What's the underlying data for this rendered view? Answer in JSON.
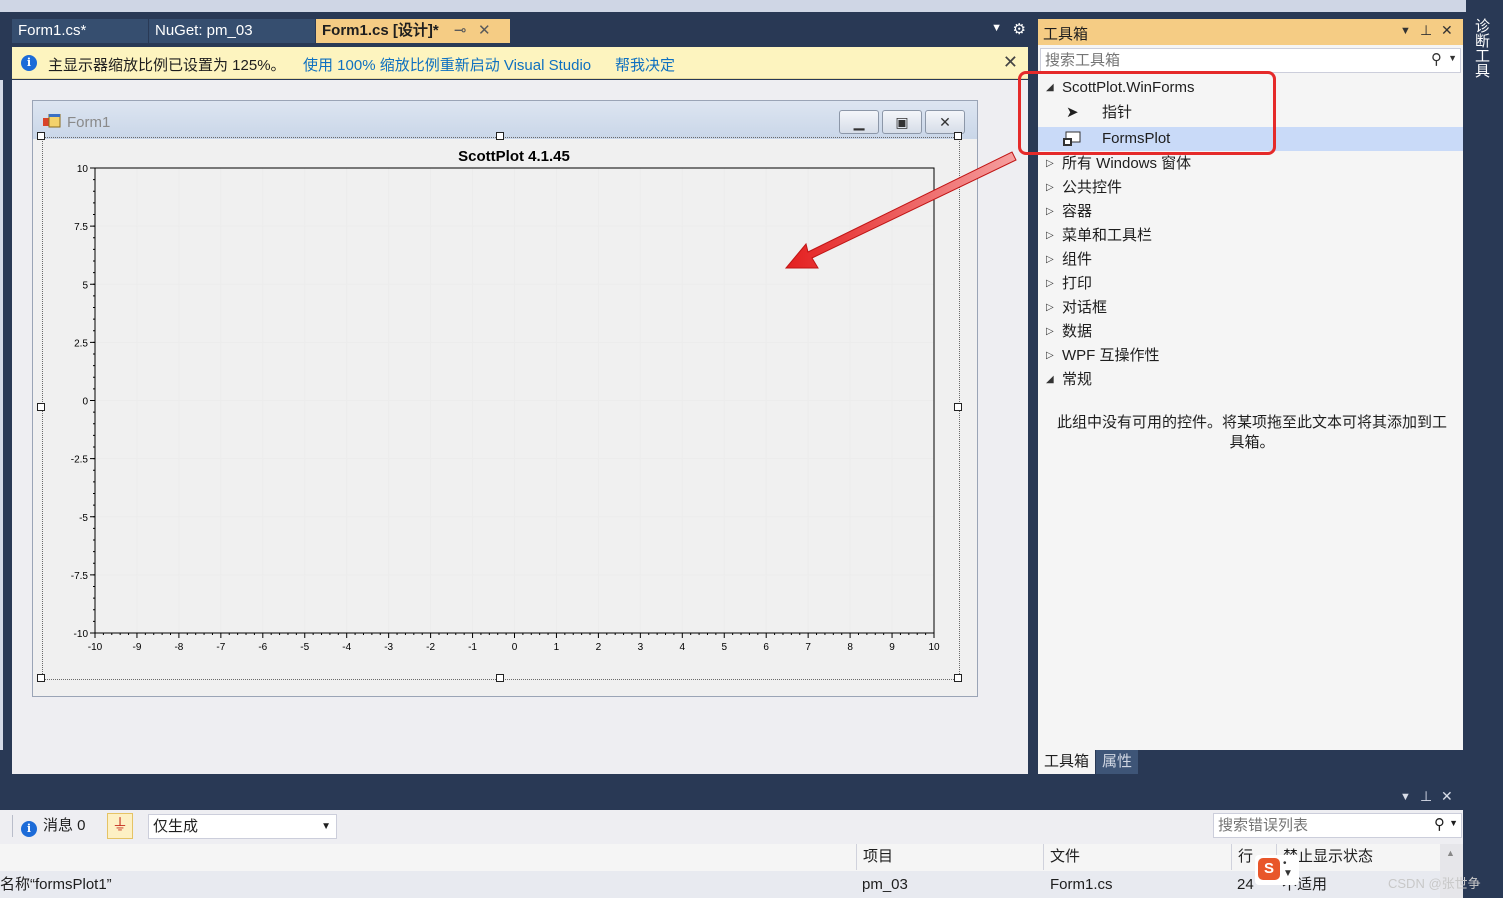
{
  "tabs": [
    {
      "label": "Form1.cs*",
      "active": false
    },
    {
      "label": "NuGet: pm_03",
      "active": false
    },
    {
      "label": "Form1.cs [设计]*",
      "active": true
    }
  ],
  "infobar": {
    "message": "主显示器缩放比例已设置为 125%。",
    "link_restart": "使用 100% 缩放比例重新启动 Visual Studio",
    "link_decide": "帮我决定"
  },
  "form": {
    "title": "Form1",
    "plot": {
      "title": "ScottPlot 4.1.45"
    }
  },
  "chart_data": {
    "type": "scatter",
    "title": "ScottPlot 4.1.45",
    "xlim": [
      -10,
      10
    ],
    "ylim": [
      -10,
      10
    ],
    "x_ticks": [
      "-10",
      "-9",
      "-8",
      "-7",
      "-6",
      "-5",
      "-4",
      "-3",
      "-2",
      "-1",
      "0",
      "1",
      "2",
      "3",
      "4",
      "5",
      "6",
      "7",
      "8",
      "9",
      "10"
    ],
    "y_ticks": [
      "10",
      "7.5",
      "5",
      "2.5",
      "0",
      "-2.5",
      "-5",
      "-7.5",
      "-10"
    ],
    "series": [],
    "grid": true
  },
  "toolbox": {
    "title": "工具箱",
    "search_placeholder": "搜索工具箱",
    "groups": [
      {
        "label": "ScottPlot.WinForms",
        "expanded": true
      },
      {
        "label": "所有 Windows 窗体",
        "expanded": false
      },
      {
        "label": "公共控件",
        "expanded": false
      },
      {
        "label": "容器",
        "expanded": false
      },
      {
        "label": "菜单和工具栏",
        "expanded": false
      },
      {
        "label": "组件",
        "expanded": false
      },
      {
        "label": "打印",
        "expanded": false
      },
      {
        "label": "对话框",
        "expanded": false
      },
      {
        "label": "数据",
        "expanded": false
      },
      {
        "label": "WPF 互操作性",
        "expanded": false
      },
      {
        "label": "常规",
        "expanded": true
      }
    ],
    "items": [
      {
        "label": "指针",
        "icon": "pointer-icon"
      },
      {
        "label": "FormsPlot",
        "icon": "formsplot-control-icon",
        "selected": true
      }
    ],
    "empty_message": "此组中没有可用的控件。将某项拖至此文本可将其添加到工具箱。",
    "bottom_tabs": [
      "工具箱",
      "属性"
    ]
  },
  "side_panel": {
    "label": "诊断工具"
  },
  "error_list": {
    "messages_label": "消息 0",
    "build_filter": "仅生成",
    "search_placeholder": "搜索错误列表",
    "columns": [
      "项目",
      "文件",
      "行",
      "禁止显示状态"
    ],
    "rows": [
      {
        "description": "名称“formsPlot1”",
        "project": "pm_03",
        "file": "Form1.cs",
        "line": "24",
        "suppression": "不适用"
      }
    ]
  },
  "watermark": "CSDN @张世争",
  "colors": {
    "accent_tab": "#f5cc84",
    "frame": "#293955",
    "highlight_box": "#e52a2a",
    "link": "#0e70c0"
  }
}
